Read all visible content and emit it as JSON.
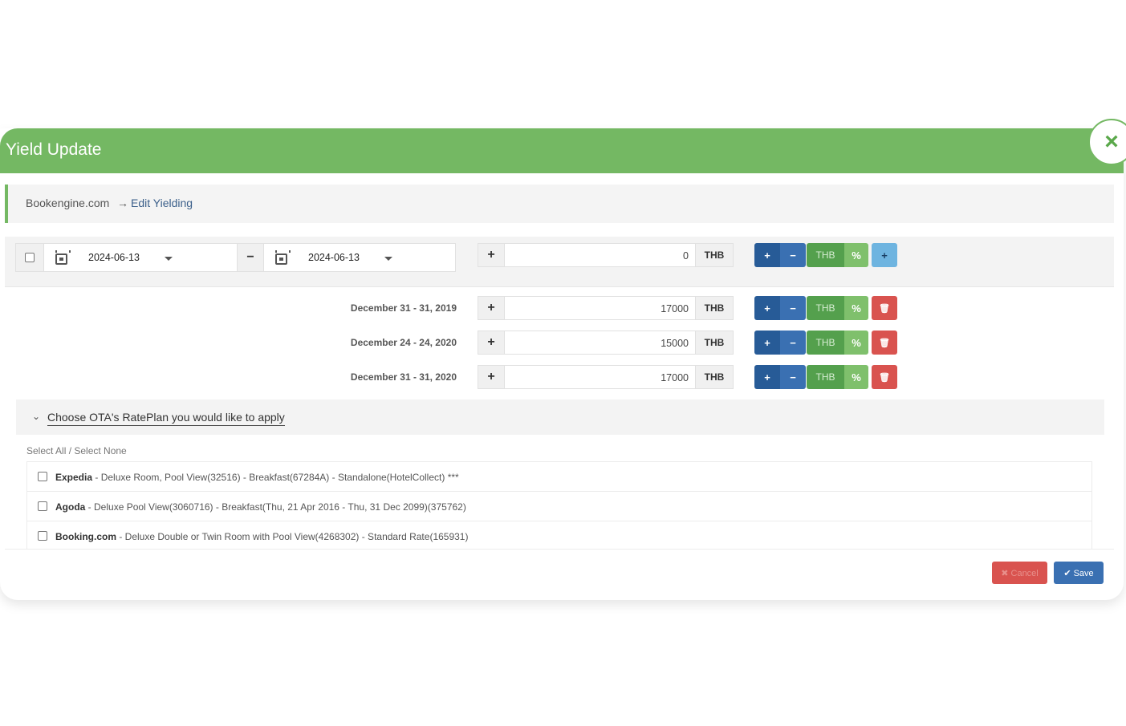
{
  "modal": {
    "title": "Yield Update",
    "close_icon": "×"
  },
  "breadcrumb": {
    "site": "Bookengine.com",
    "arrow": "→",
    "page": "Edit Yielding"
  },
  "filter": {
    "date_from": "2024-06-13",
    "date_to": "2024-06-13",
    "minus_symbol": "−",
    "plus_symbol": "+",
    "amount": "0",
    "currency": "THB"
  },
  "buttons": {
    "plus": "+",
    "minus": "−",
    "thb": "THB",
    "percent": "%",
    "add": "+",
    "delete": "🗑"
  },
  "ranges": [
    {
      "label": "December 31 - 31, 2019",
      "amount": "17000",
      "currency": "THB"
    },
    {
      "label": "December 24 - 24, 2020",
      "amount": "15000",
      "currency": "THB"
    },
    {
      "label": "December 31 - 31, 2020",
      "amount": "17000",
      "currency": "THB"
    }
  ],
  "ota": {
    "title": "Choose OTA's RatePlan you would like to apply",
    "chevron": "⌄",
    "select_all": "Select All / Select None",
    "items": [
      {
        "name": "Expedia",
        "detail": " - Deluxe Room, Pool View(32516) - Breakfast(67284A) - Standalone(HotelCollect) ***"
      },
      {
        "name": "Agoda",
        "detail": " - Deluxe Pool View(3060716) - Breakfast(Thu, 21 Apr 2016 - Thu, 31 Dec 2099)(375762)"
      },
      {
        "name": "Booking.com",
        "detail": " - Deluxe Double or Twin Room with Pool View(4268302) - Standard Rate(165931)"
      }
    ]
  },
  "footer": {
    "cancel_label": "✖ Cancel",
    "save_label": "✔ Save"
  },
  "colors": {
    "header_green": "#74b863",
    "primary_blue": "#275b97",
    "danger_red": "#d9534f",
    "info_blue": "#6eb4e0"
  }
}
